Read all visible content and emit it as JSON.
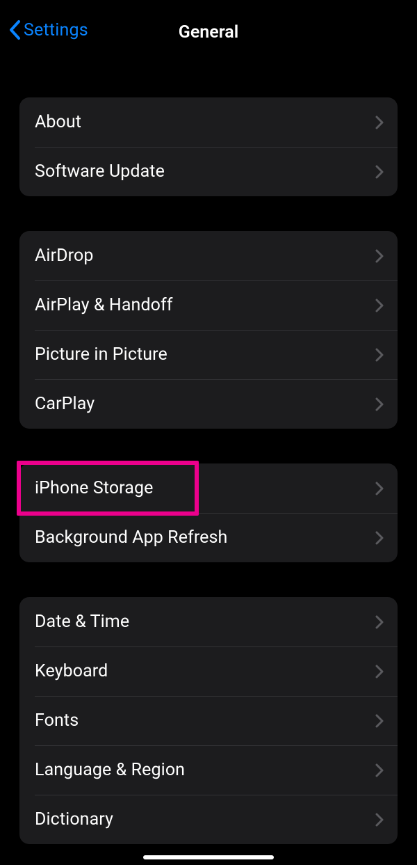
{
  "header": {
    "back_label": "Settings",
    "title": "General"
  },
  "groups": [
    {
      "rows": [
        {
          "label": "About",
          "name": "row-about"
        },
        {
          "label": "Software Update",
          "name": "row-software-update"
        }
      ]
    },
    {
      "rows": [
        {
          "label": "AirDrop",
          "name": "row-airdrop"
        },
        {
          "label": "AirPlay & Handoff",
          "name": "row-airplay-handoff"
        },
        {
          "label": "Picture in Picture",
          "name": "row-picture-in-picture"
        },
        {
          "label": "CarPlay",
          "name": "row-carplay"
        }
      ]
    },
    {
      "rows": [
        {
          "label": "iPhone Storage",
          "name": "row-iphone-storage",
          "highlighted": true
        },
        {
          "label": "Background App Refresh",
          "name": "row-background-app-refresh"
        }
      ]
    },
    {
      "rows": [
        {
          "label": "Date & Time",
          "name": "row-date-time"
        },
        {
          "label": "Keyboard",
          "name": "row-keyboard"
        },
        {
          "label": "Fonts",
          "name": "row-fonts"
        },
        {
          "label": "Language & Region",
          "name": "row-language-region"
        },
        {
          "label": "Dictionary",
          "name": "row-dictionary"
        }
      ]
    }
  ]
}
